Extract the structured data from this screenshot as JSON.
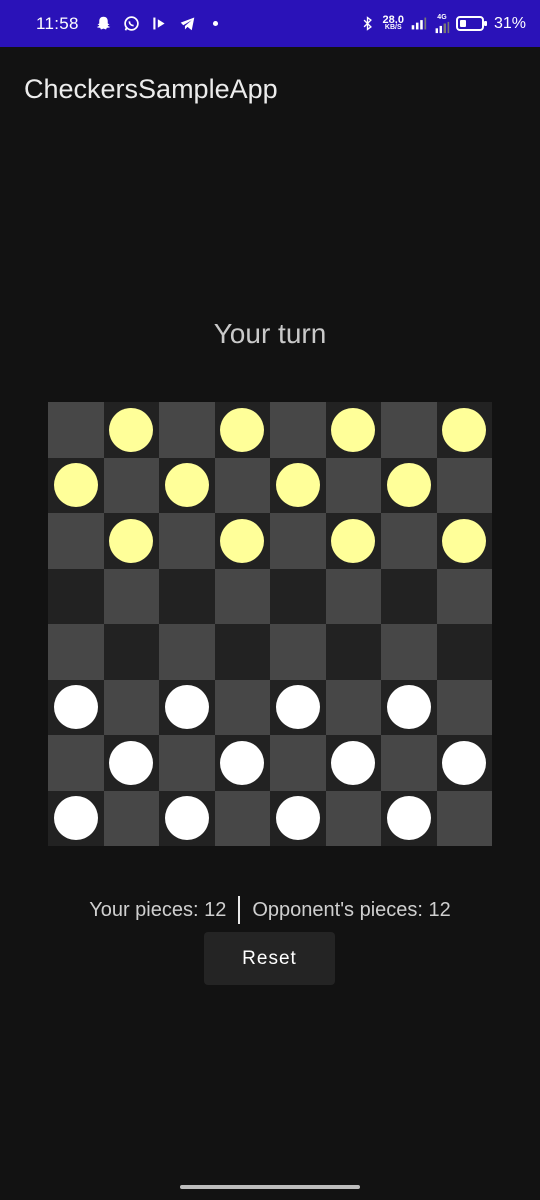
{
  "status_bar": {
    "time": "11:58",
    "net_speed_value": "28.0",
    "net_speed_unit": "KB/S",
    "network": "4G",
    "battery_percent": "31%",
    "battery_level": 0.31,
    "notification_icons": [
      "snapchat-icon",
      "whatsapp-icon",
      "media-icon",
      "telegram-icon",
      "dot-icon"
    ]
  },
  "app": {
    "title": "CheckersSampleApp"
  },
  "game": {
    "turn_text": "Your turn",
    "board_rows": [
      ".Y.Y.Y.Y",
      "Y.Y.Y.Y.",
      ".Y.Y.Y.Y",
      "........",
      "........",
      "W.W.W.W.",
      ".W.W.W.W",
      "W.W.W.W."
    ],
    "your_pieces": "Your pieces: 12",
    "opponent_pieces": "Opponent's pieces: 12",
    "reset_label": "Reset"
  },
  "colors": {
    "status_bar": "#2a12b8",
    "background": "#121212",
    "light_square": "#474747",
    "dark_square": "#222222",
    "opponent_piece": "#ffff99",
    "player_piece": "#ffffff"
  }
}
